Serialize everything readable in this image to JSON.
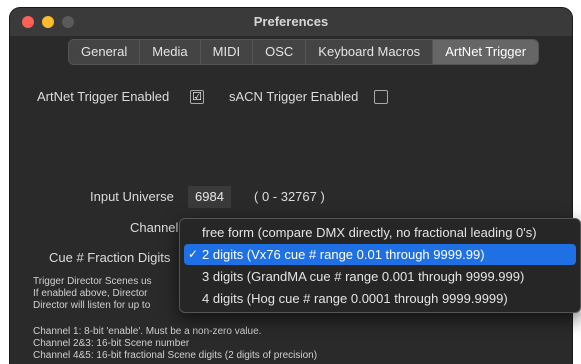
{
  "window": {
    "title": "Preferences"
  },
  "tabs": [
    {
      "label": "General"
    },
    {
      "label": "Media"
    },
    {
      "label": "MIDI"
    },
    {
      "label": "OSC"
    },
    {
      "label": "Keyboard Macros"
    },
    {
      "label": "ArtNet Trigger"
    }
  ],
  "artnet": {
    "artnet_enabled_label": "ArtNet Trigger Enabled",
    "artnet_checked": "☑",
    "sacn_enabled_label": "sACN Trigger Enabled"
  },
  "input_universe": {
    "label": "Input Universe",
    "value": "6984",
    "range": "( 0 - 32767 )"
  },
  "channel": {
    "label": "Channel"
  },
  "cue_fraction": {
    "label": "Cue # Fraction Digits",
    "options": [
      {
        "label": "free form (compare DMX directly, no fractional leading 0's)",
        "selected": false
      },
      {
        "label": "2 digits (Vx76 cue # range 0.01 through 9999.99)",
        "selected": true
      },
      {
        "label": "3 digits (GrandMA cue # range 0.001 through 9999.999)",
        "selected": false
      },
      {
        "label": "4 digits (Hog cue # range 0.0001 through 9999.9999)",
        "selected": false
      }
    ],
    "check_glyph": "✓"
  },
  "help_text": {
    "line1": "Trigger Director Scenes us",
    "line2": "If enabled above, Director",
    "line3": "Director will listen for up to",
    "line4": "Channel 1: 8-bit 'enable'.  Must be a non-zero value.",
    "line5": "Channel 2&3:  16-bit Scene number",
    "line6": "Channel 4&5:  16-bit fractional Scene digits (2 digits of precision)"
  },
  "colors": {
    "accent": "#1f6fe5",
    "window_bg": "#2a2a2a"
  }
}
